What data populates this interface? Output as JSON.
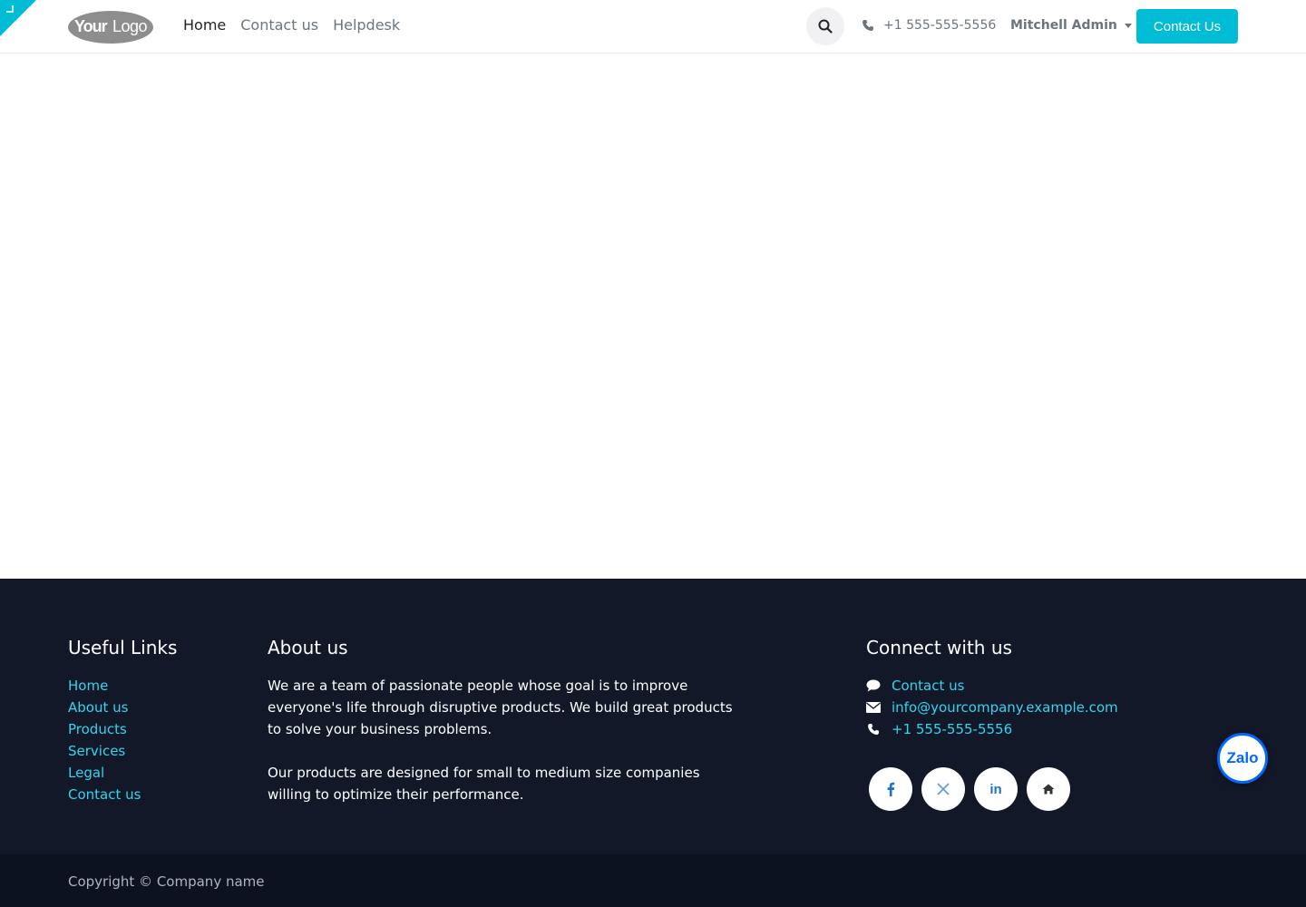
{
  "header": {
    "logo_text": "YourLogo",
    "nav": [
      {
        "label": "Home"
      },
      {
        "label": "Contact us"
      },
      {
        "label": "Helpdesk"
      }
    ],
    "phone": "+1 555-555-5556",
    "user": "Mitchell Admin",
    "cta_label": "Contact Us",
    "accent": "#00bcd4"
  },
  "footer": {
    "useful_links": {
      "title": "Useful Links",
      "items": [
        "Home",
        "About us",
        "Products",
        "Services",
        "Legal",
        "Contact us"
      ]
    },
    "about": {
      "title": "About us",
      "p1": "We are a team of passionate people whose goal is to improve everyone's life through disruptive products. We build great products to solve your business problems.",
      "p2": "Our products are designed for small to medium size companies willing to optimize their performance."
    },
    "connect": {
      "title": "Connect with us",
      "contact": "Contact us",
      "email": "info@yourcompany.example.com",
      "phone": "+1 555-555-5556",
      "socials": [
        "facebook-icon",
        "x-icon",
        "linkedin-icon",
        "home-icon"
      ]
    },
    "copyright": "Copyright © Company name",
    "background": "#121828",
    "link_color": "#32d4f0"
  },
  "zalo": {
    "label": "Zalo"
  }
}
